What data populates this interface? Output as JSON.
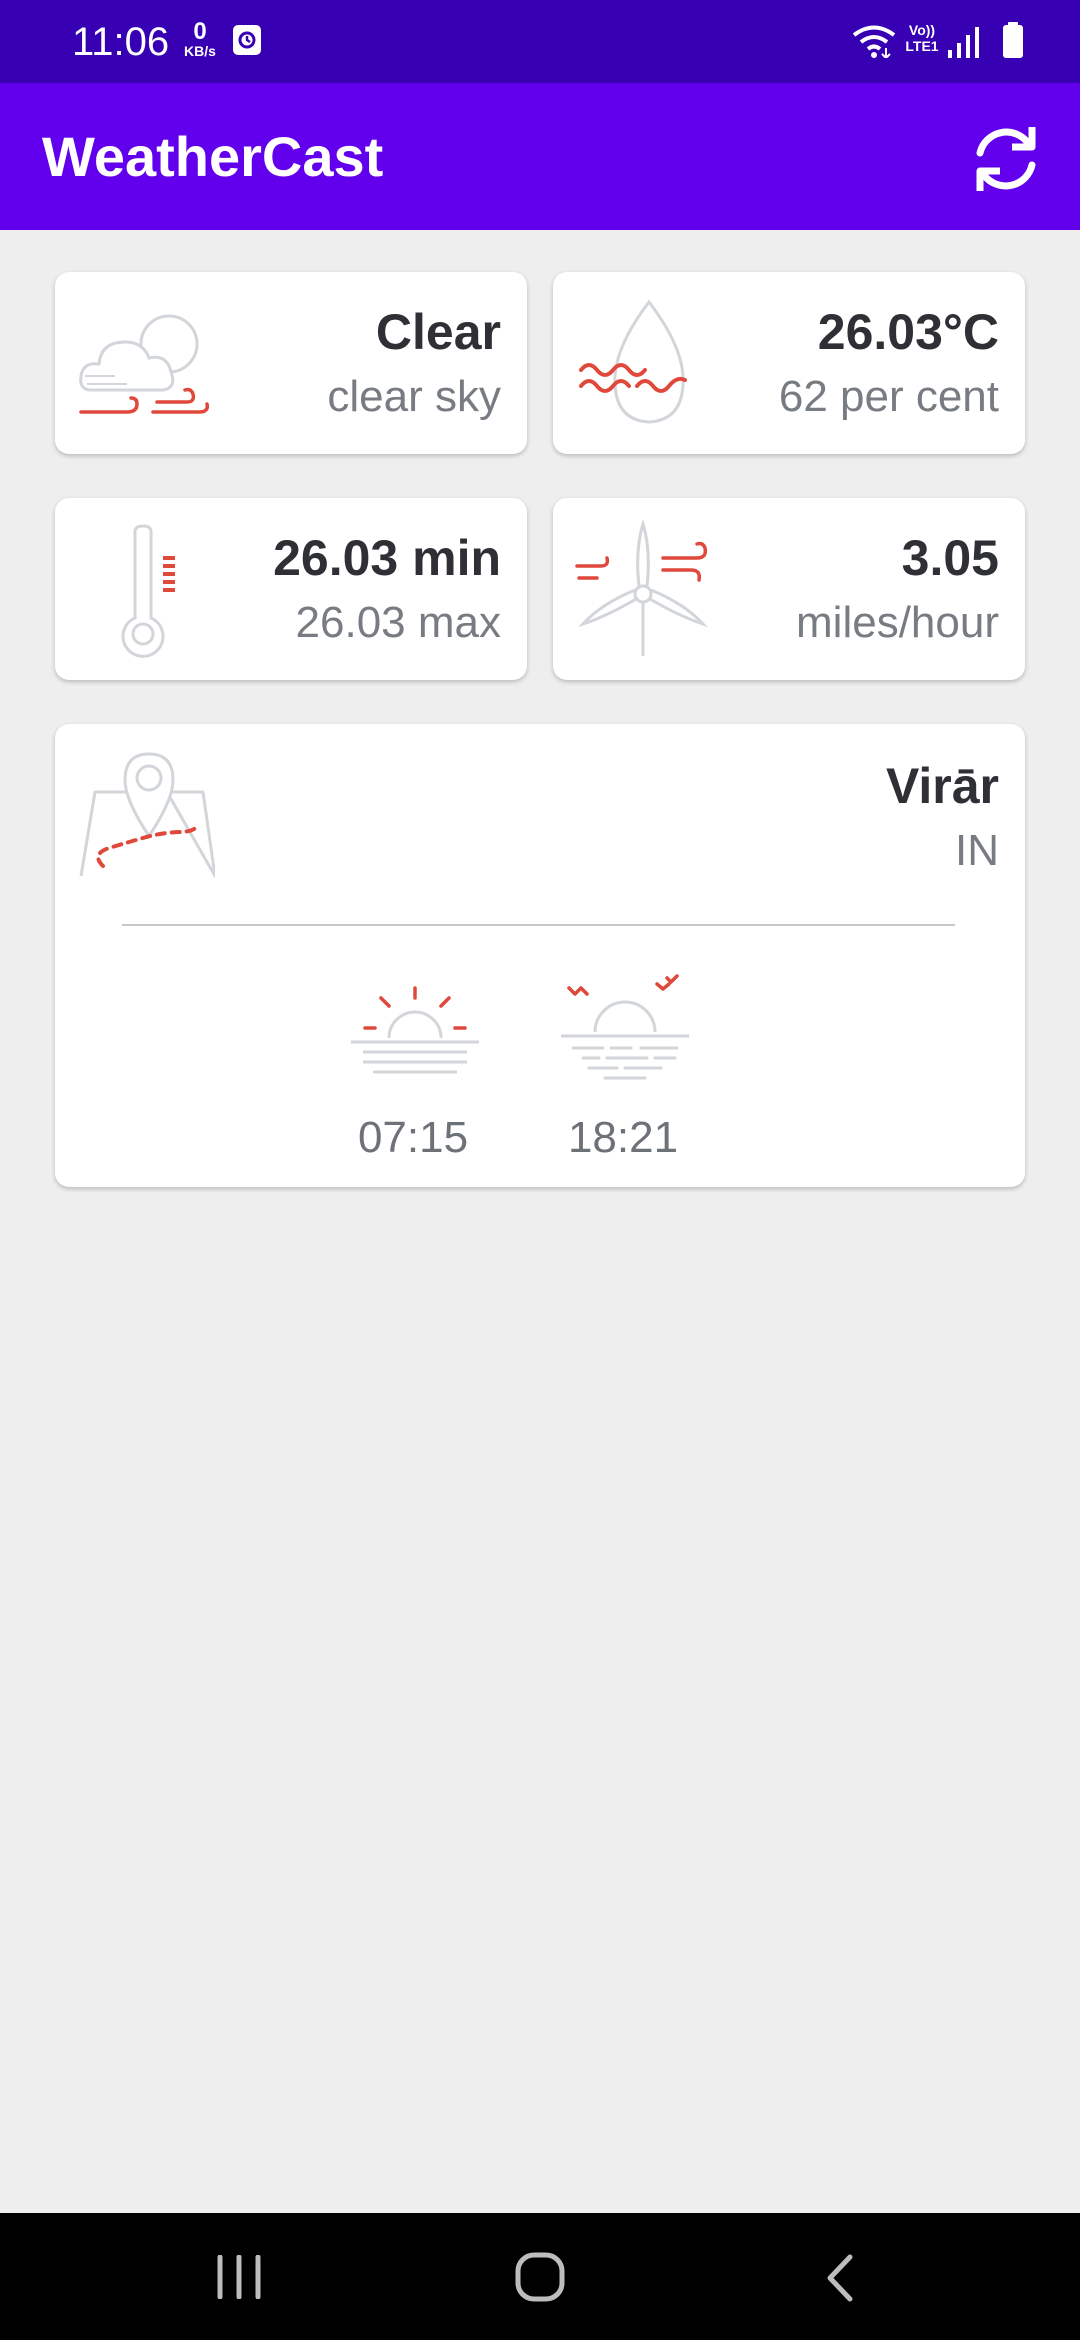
{
  "status_bar": {
    "time": "11:06",
    "data_speed_value": "0",
    "data_speed_unit": "KB/s",
    "network_label_top": "Vo))",
    "network_label_bottom": "LTE1",
    "background": "#3700b3"
  },
  "app_bar": {
    "title": "WeatherCast",
    "refresh_icon": "refresh-icon",
    "background": "#6200ee"
  },
  "cards": {
    "condition": {
      "main": "Clear",
      "description": "clear sky",
      "icon": "cloudy-wind-icon"
    },
    "temperature": {
      "temp": "26.03°C",
      "humidity": "62 per cent",
      "icon": "humidity-drop-icon"
    },
    "min_max": {
      "min": "26.03 min",
      "max": "26.03 max",
      "icon": "thermometer-icon"
    },
    "wind": {
      "speed": "3.05",
      "unit": "miles/hour",
      "icon": "wind-turbine-icon"
    },
    "location": {
      "city": "Virār",
      "country": "IN",
      "icon": "map-pin-icon",
      "sunrise": "07:15",
      "sunset": "18:21",
      "sunrise_icon": "sunrise-icon",
      "sunset_icon": "sunset-icon"
    }
  },
  "colors": {
    "accent_red": "#e0483b",
    "icon_gray": "#c9cdd2",
    "text_dark": "#2f3035",
    "text_muted": "#777b82"
  },
  "nav_bar": {
    "recents_icon": "recents-icon",
    "home_icon": "home-icon",
    "back_icon": "back-icon"
  }
}
